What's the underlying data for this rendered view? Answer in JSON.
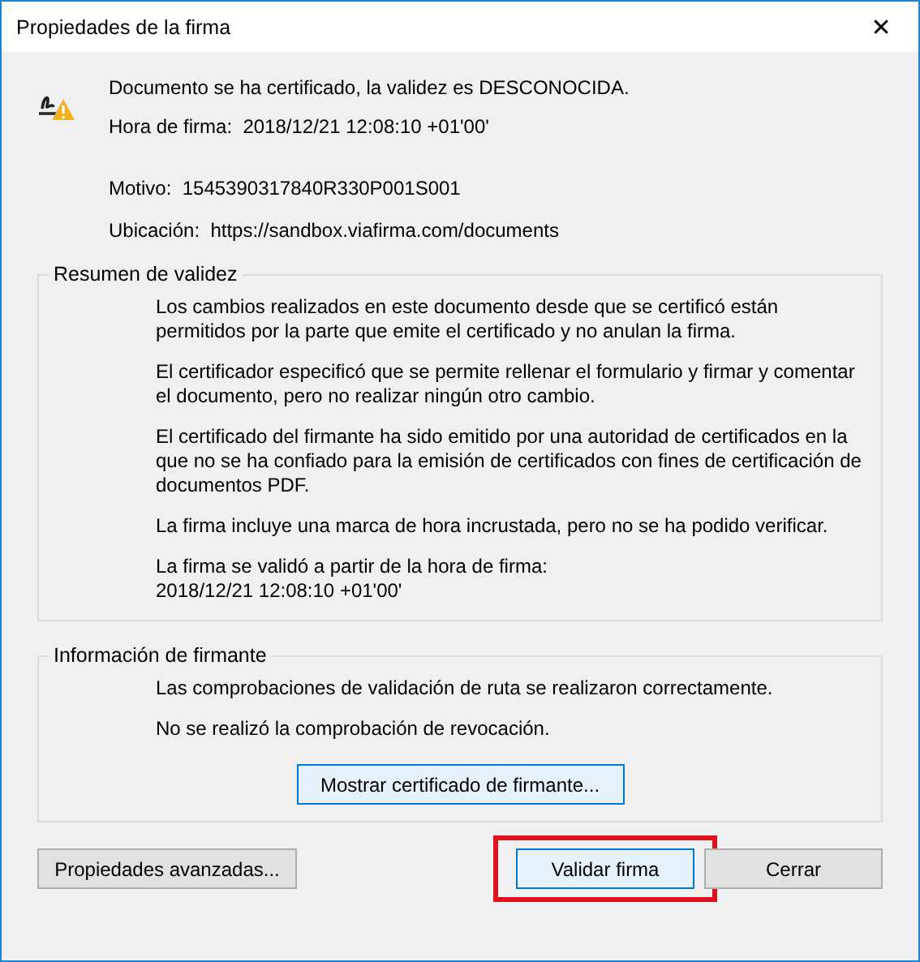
{
  "window": {
    "title": "Propiedades de la firma",
    "close": "✕"
  },
  "header": {
    "status": "Documento se ha certificado, la validez es DESCONOCIDA.",
    "signing_time": {
      "label": "Hora de firma:",
      "value": "2018/12/21 12:08:10 +01'00'"
    },
    "details": [
      {
        "label": "Motivo:",
        "value": "1545390317840R330P001S001"
      },
      {
        "label": "Ubicación:",
        "value": "https://sandbox.viafirma.com/documents"
      }
    ]
  },
  "groups": [
    {
      "title": "Resumen de validez",
      "paragraphs": [
        "Los cambios realizados en este documento desde que se certificó están permitidos por la parte que emite el certificado y no anulan la firma.",
        "El certificador especificó que se permite rellenar el formulario y firmar y comentar el documento, pero no realizar ningún otro cambio.",
        "El certificado del firmante ha sido emitido por una autoridad de certificados en la que no se ha confiado para la emisión de certificados con fines de certificación de documentos PDF.",
        "La firma incluye una marca de hora incrustada, pero no se ha podido verificar.",
        "La firma se validó a partir de la hora de firma:\n2018/12/21 12:08:10 +01'00'"
      ]
    },
    {
      "title": "Información de firmante",
      "paragraphs": [
        "Las comprobaciones de validación de ruta se realizaron correctamente.",
        "No se realizó la comprobación de revocación."
      ],
      "button": {
        "label": "Mostrar certificado de firmante...",
        "default": true
      }
    }
  ],
  "buttons": [
    {
      "label": "Propiedades avanzadas...",
      "default": false,
      "highlighted": false
    },
    {
      "label": "Validar firma",
      "default": true,
      "highlighted": true
    },
    {
      "label": "Cerrar",
      "default": false,
      "highlighted": false
    }
  ]
}
